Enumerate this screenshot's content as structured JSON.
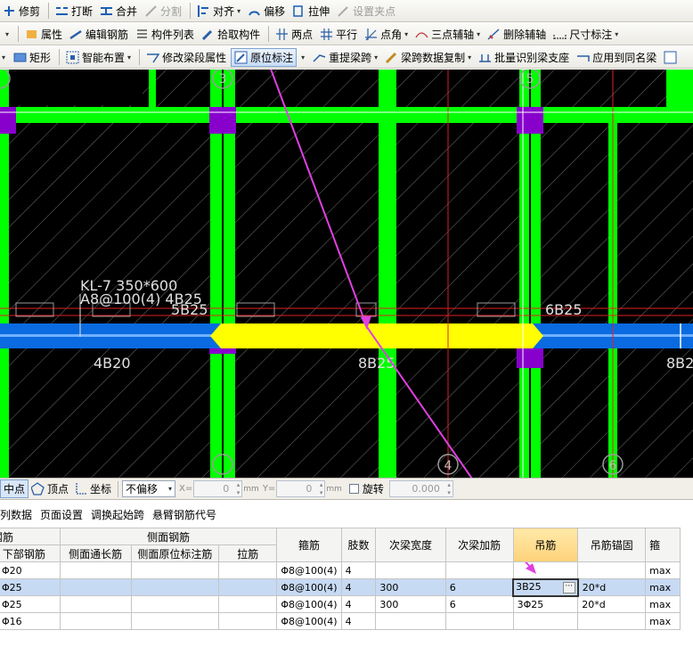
{
  "toolbar1": [
    {
      "label": "修剪",
      "icon": "trim-icon",
      "disabled": false
    },
    {
      "label": "打断",
      "icon": "break-icon",
      "disabled": false
    },
    {
      "label": "合并",
      "icon": "merge-icon",
      "disabled": false
    },
    {
      "label": "分割",
      "icon": "split-icon",
      "disabled": true
    },
    {
      "label": "对齐",
      "icon": "align-icon",
      "disabled": false,
      "dropdown": true
    },
    {
      "label": "偏移",
      "icon": "offset-icon",
      "disabled": false
    },
    {
      "label": "拉伸",
      "icon": "stretch-icon",
      "disabled": false
    },
    {
      "label": "设置夹点",
      "icon": "grip-point-icon",
      "disabled": true
    }
  ],
  "toolbar2": [
    {
      "label": "属性",
      "icon": "properties-icon"
    },
    {
      "label": "编辑钢筋",
      "icon": "edit-rebar-icon"
    },
    {
      "label": "构件列表",
      "icon": "component-list-icon"
    },
    {
      "label": "拾取构件",
      "icon": "pick-component-icon"
    },
    {
      "label": "两点",
      "icon": "two-point-axis-icon"
    },
    {
      "label": "平行",
      "icon": "parallel-axis-icon"
    },
    {
      "label": "点角",
      "icon": "point-angle-icon",
      "dropdown": true
    },
    {
      "label": "三点辅轴",
      "icon": "three-point-axis-icon",
      "dropdown": true
    },
    {
      "label": "删除辅轴",
      "icon": "delete-axis-icon"
    },
    {
      "label": "尺寸标注",
      "icon": "dimension-icon",
      "dropdown": true
    }
  ],
  "toolbar3": [
    {
      "label": "矩形",
      "icon": "rectangle-icon"
    },
    {
      "label": "智能布置",
      "icon": "smart-layout-icon",
      "dropdown": true
    },
    {
      "label": "修改梁段属性",
      "icon": "modify-beam-icon"
    },
    {
      "label": "原位标注",
      "icon": "in-situ-annotation-icon",
      "active": true,
      "dropdown": true
    },
    {
      "label": "重提梁跨",
      "icon": "re-extract-span-icon",
      "dropdown": true
    },
    {
      "label": "梁跨数据复制",
      "icon": "copy-span-data-icon",
      "dropdown": true
    },
    {
      "label": "批量识别梁支座",
      "icon": "batch-support-icon"
    },
    {
      "label": "应用到同名梁",
      "icon": "apply-same-name-icon"
    }
  ],
  "canvas": {
    "axis_labels": [
      "3",
      "5",
      "4",
      "6"
    ],
    "beam_texts": [
      "KL-7 350*600",
      "A8@100(4) 4B25",
      "5B25",
      "6B25",
      "4B20",
      "8B25",
      "8B2"
    ]
  },
  "statusbar": {
    "midpoint": "中点",
    "vertex": "顶点",
    "coordinate": "坐标",
    "offset_mode": "不偏移",
    "x_label": "X=",
    "x_value": "0",
    "y_label": "Y=",
    "y_value": "0",
    "unit": "mm",
    "rotate_label": "旋转",
    "rotate_value": "0.000"
  },
  "menubar": [
    "列数据",
    "页面设置",
    "调换起始跨",
    "悬臂钢筋代号"
  ],
  "table": {
    "group_headers": {
      "bottom_rebar": "钢筋",
      "side_rebar": "侧面钢筋"
    },
    "columns": [
      "下部钢筋",
      "侧面通长筋",
      "侧面原位标注筋",
      "拉筋",
      "箍筋",
      "肢数",
      "次梁宽度",
      "次梁加筋",
      "吊筋",
      "吊筋锚固",
      "箍"
    ],
    "selected_column": "吊筋",
    "rows": [
      {
        "cells": [
          "Φ20",
          "",
          "",
          "",
          "Φ8@100(4)",
          "4",
          "",
          "",
          "",
          "",
          "max"
        ],
        "selected": false
      },
      {
        "cells": [
          "Φ25",
          "",
          "",
          "",
          "Φ8@100(4)",
          "4",
          "300",
          "6",
          "3B25",
          "20*d",
          "max"
        ],
        "selected": true
      },
      {
        "cells": [
          "Φ25",
          "",
          "",
          "",
          "Φ8@100(4)",
          "4",
          "300",
          "6",
          "3Φ25",
          "20*d",
          "max"
        ],
        "selected": false
      },
      {
        "cells": [
          "Φ16",
          "",
          "",
          "",
          "Φ8@100(4)",
          "4",
          "",
          "",
          "",
          "",
          "max"
        ]
      }
    ],
    "editing_cell": {
      "row": 1,
      "column": "吊筋"
    }
  },
  "colors": {
    "canvas_bg": "#000000",
    "column_green": "#00ff00",
    "support_purple": "#8800cc",
    "beam_blue": "#0a6be0",
    "selected_span_yellow": "#ffff00",
    "callout_arrow_magenta": "#e040e0",
    "header_highlight": "#ffd27a",
    "selected_row": "#c7daf3"
  }
}
